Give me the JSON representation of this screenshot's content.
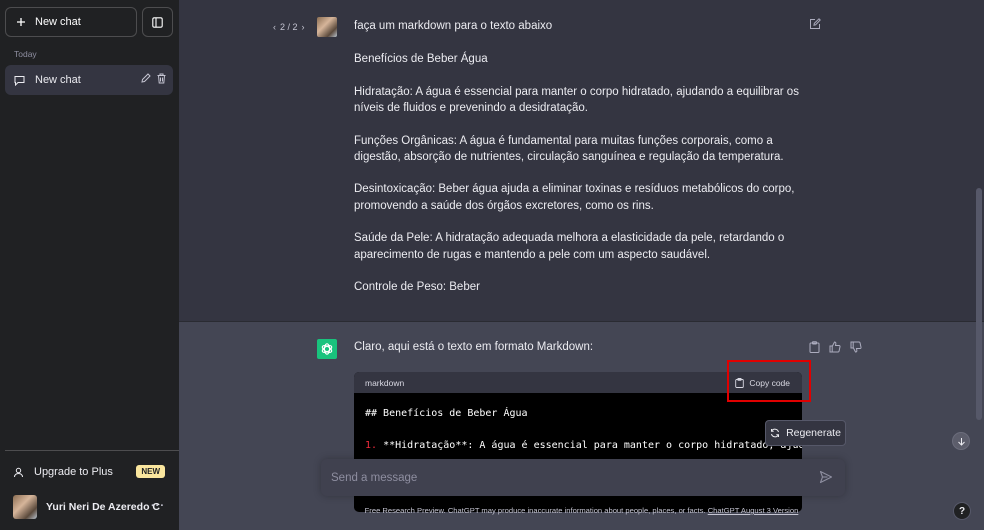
{
  "sidebar": {
    "new_chat_label": "New chat",
    "section_today": "Today",
    "chat_item_label": "New chat",
    "upgrade_label": "Upgrade to Plus",
    "upgrade_badge": "NEW",
    "user_name": "Yuri Neri De Azeredo C",
    "user_more": "···"
  },
  "user_message": {
    "pager": {
      "prev": "‹",
      "text": "2 / 2",
      "next": "›"
    },
    "paragraphs": [
      "faça um markdown para o texto abaixo",
      "Benefícios de Beber Água",
      "Hidratação: A água é essencial para manter o corpo hidratado, ajudando a equilibrar os níveis de fluidos e prevenindo a desidratação.",
      "Funções Orgânicas: A água é fundamental para muitas funções corporais, como a digestão, absorção de nutrientes, circulação sanguínea e regulação da temperatura.",
      "Desintoxicação: Beber água ajuda a eliminar toxinas e resíduos metabólicos do corpo, promovendo a saúde dos órgãos excretores, como os rins.",
      "Saúde da Pele: A hidratação adequada melhora a elasticidade da pele, retardando o aparecimento de rugas e mantendo a pele com um aspecto saudável.",
      "Controle de Peso: Beber"
    ]
  },
  "assistant_message": {
    "text": "Claro, aqui está o texto em formato Markdown:",
    "code": {
      "language": "markdown",
      "copy_label": "Copy code",
      "line1": "## Benefícios de Beber Água",
      "line2_num": "1.",
      "line2_text": " **Hidratação**: A água é essencial para manter o corpo hidratado, ajudand"
    }
  },
  "regenerate_label": "Regenerate",
  "composer": {
    "placeholder": "Send a message"
  },
  "footer": {
    "text": "Free Research Preview. ChatGPT may produce inaccurate information about people, places, or facts. ",
    "link": "ChatGPT August 3 Version"
  },
  "help_label": "?",
  "colors": {
    "highlight": "#e00000",
    "gpt_green": "#19c37d",
    "badge": "#fae69e"
  }
}
